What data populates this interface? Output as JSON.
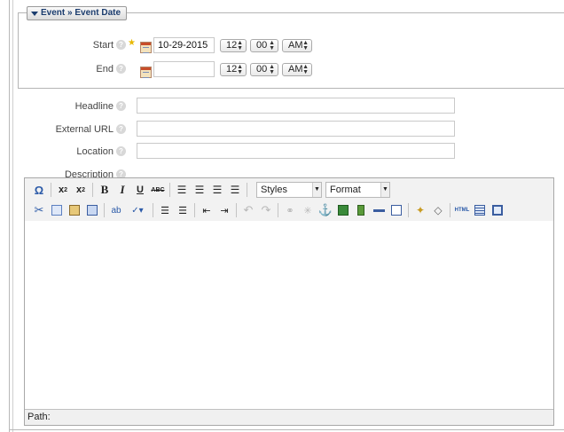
{
  "event_date": {
    "legend": "Event » Event Date",
    "start": {
      "label": "Start",
      "date": "10-29-2015",
      "hour": "12",
      "minute": "00",
      "ampm": "AM"
    },
    "end": {
      "label": "End",
      "date": "",
      "hour": "12",
      "minute": "00",
      "ampm": "AM"
    }
  },
  "fields": {
    "headline_label": "Headline",
    "headline_value": "",
    "external_url_label": "External URL",
    "external_url_value": "",
    "location_label": "Location",
    "location_value": "",
    "description_label": "Description"
  },
  "editor": {
    "styles_value": "Styles",
    "format_value": "Format",
    "path_label": "Path:",
    "html_label": "HTML",
    "abc_label": "ABC",
    "toolbar_row1": [
      "omega-icon",
      "subscript-icon",
      "superscript-icon",
      "bold-icon",
      "italic-icon",
      "underline-icon",
      "strikethrough-icon",
      "align-left-icon",
      "align-center-icon",
      "align-right-icon",
      "align-justify-icon"
    ],
    "toolbar_row2": [
      "cut-icon",
      "copy-icon",
      "paste-icon",
      "paste-word-icon",
      "find-replace-icon",
      "spellcheck-icon",
      "bullet-list-icon",
      "numbered-list-icon",
      "outdent-icon",
      "indent-icon",
      "undo-icon",
      "redo-icon",
      "link-icon",
      "unlink-icon",
      "anchor-icon",
      "image-icon",
      "media-icon",
      "horizontal-rule-icon",
      "edit-icon",
      "cleanup-icon",
      "eraser-icon",
      "html-icon",
      "table-icon",
      "fullscreen-icon"
    ]
  },
  "colors": {
    "legend_text": "#1b3c6e",
    "star": "#e8b800",
    "icon_blue": "#2b5aa8"
  }
}
